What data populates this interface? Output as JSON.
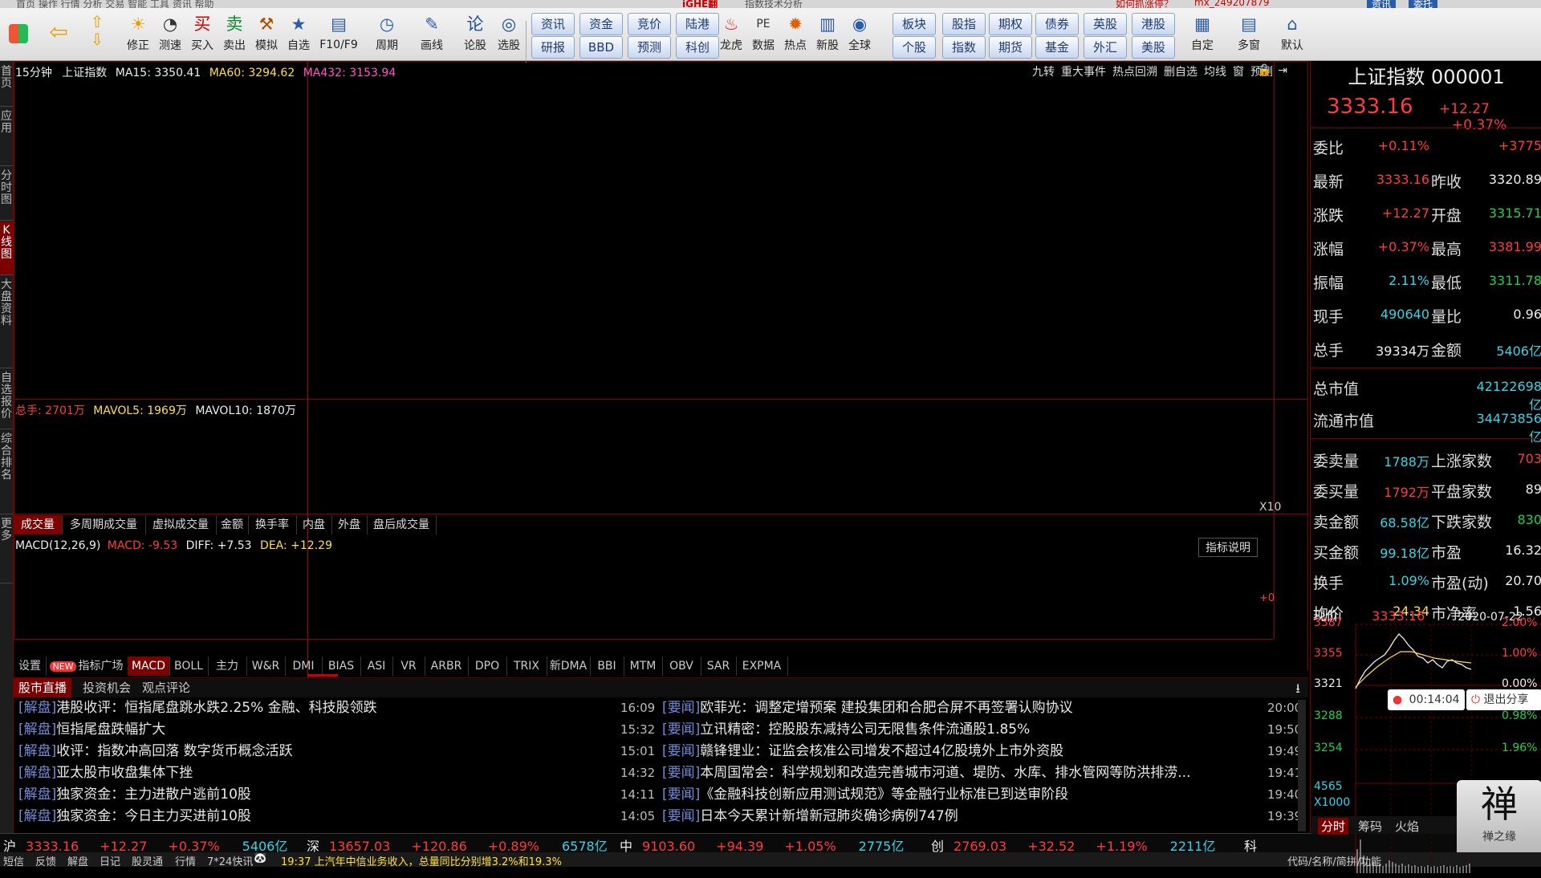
{
  "titlebar": {
    "center": "指数技术分析",
    "promo": "如何抓涨停？",
    "user": "mx_249207879",
    "btn_a": "资讯",
    "btn_b": "委托"
  },
  "toolbar": {
    "icon_buttons": [
      {
        "label": "修正",
        "icon": "hammer-fix-icon"
      },
      {
        "label": "测速",
        "icon": "clock-icon"
      },
      {
        "label": "买入",
        "icon": "buy-icon",
        "glyph": "买"
      },
      {
        "label": "卖出",
        "icon": "sell-icon",
        "glyph": "卖"
      },
      {
        "label": "模拟",
        "icon": "gavel-icon"
      },
      {
        "label": "自选",
        "icon": "star-icon"
      },
      {
        "label": "F10/F9",
        "icon": "document-icon"
      },
      {
        "label": "周期",
        "icon": "cycle-icon"
      },
      {
        "label": "画线",
        "icon": "pencil-icon"
      },
      {
        "label": "论股",
        "icon": "discuss-icon",
        "glyph": "论"
      },
      {
        "label": "选股",
        "icon": "select-stock-icon"
      }
    ],
    "pills_row1": [
      "资讯",
      "资金",
      "竞价",
      "陆港"
    ],
    "pills_row2": [
      "研报",
      "BBD",
      "预测",
      "科创"
    ],
    "mid_buttons": [
      {
        "label": "龙虎",
        "icon": "dragon-icon"
      },
      {
        "label": "数据",
        "icon": "pe-data-icon",
        "glyph": "PE"
      },
      {
        "label": "热点",
        "icon": "hot-icon"
      },
      {
        "label": "新股",
        "icon": "new-stock-icon"
      },
      {
        "label": "全球",
        "icon": "globe-icon"
      }
    ],
    "pills2_row1": [
      "板块",
      "股指",
      "期权",
      "债券",
      "英股",
      "港股"
    ],
    "pills2_row2": [
      "个股",
      "指数",
      "期货",
      "基金",
      "外汇",
      "美股"
    ],
    "right_buttons": [
      {
        "label": "自定",
        "icon": "custom-icon"
      },
      {
        "label": "多窗",
        "icon": "multi-window-icon"
      },
      {
        "label": "默认",
        "icon": "home-icon"
      }
    ]
  },
  "left_tabs": [
    "首页",
    "应用",
    "分时图",
    "K线图",
    "大盘资料",
    "自选报价",
    "综合排名",
    "更多"
  ],
  "chart": {
    "period": "15分钟",
    "name": "上证指数",
    "ma15": "MA15: 3350.41",
    "ma60": "MA60: 3294.62",
    "ma432": "MA432: 3153.94",
    "tools": [
      "九转",
      "重大事件",
      "热点回溯",
      "删自选",
      "均线",
      "窗",
      "预测"
    ],
    "vol_total": "总手: 2701万",
    "mavol5": "MAVOL5: 1969万",
    "mavol10": "MAVOL10: 1870万",
    "x10": "X10",
    "vol_tabs": [
      "成交量",
      "多周期成交量",
      "虚拟成交量",
      "金额",
      "换手率",
      "内盘",
      "外盘",
      "盘后成交量"
    ],
    "macd_name": "MACD(12,26,9)",
    "macd": "MACD: -9.53",
    "diff": "DIFF: +7.53",
    "dea": "DEA: +12.29",
    "ind_help": "指标说明",
    "zero": "+0"
  },
  "indicator_tabs": [
    "设置",
    "指标广场",
    "MACD",
    "BOLL",
    "主力",
    "W&R",
    "DMI",
    "BIAS",
    "ASI",
    "VR",
    "ARBR",
    "DPO",
    "TRIX",
    "新DMA",
    "BBI",
    "MTM",
    "OBV",
    "SAR",
    "EXPMA"
  ],
  "new_badge": "NEW",
  "news_tabs": [
    "股市直播",
    "投资机会",
    "观点评论"
  ],
  "news_left": [
    {
      "tag": "[解盘]",
      "title": "港股收评：恒指尾盘跳水跌2.25% 金融、科技股领跌",
      "time": "16:09"
    },
    {
      "tag": "[解盘]",
      "title": "恒指尾盘跌幅扩大",
      "time": "15:32"
    },
    {
      "tag": "[解盘]",
      "title": "收评：指数冲高回落 数字货币概念活跃",
      "time": "15:01"
    },
    {
      "tag": "[解盘]",
      "title": "亚太股市收盘集体下挫",
      "time": "14:32"
    },
    {
      "tag": "[解盘]",
      "title": "独家资金：主力进散户逃前10股",
      "time": "14:11"
    },
    {
      "tag": "[解盘]",
      "title": "独家资金：今日主力买进前10股",
      "time": "14:05"
    }
  ],
  "news_right": [
    {
      "tag": "[要闻]",
      "title": "欧菲光：调整定增预案 建投集团和合肥合屏不再签署认购协议",
      "time": "20:00"
    },
    {
      "tag": "[要闻]",
      "title": "立讯精密：控股股东减持公司无限售条件流通股1.85%",
      "time": "19:50"
    },
    {
      "tag": "[要闻]",
      "title": "赣锋锂业：证监会核准公司增发不超过4亿股境外上市外资股",
      "time": "19:49"
    },
    {
      "tag": "[要闻]",
      "title": "本周国常会：科学规划和改造完善城市河道、堤防、水库、排水管网等防洪排涝...",
      "time": "19:41"
    },
    {
      "tag": "[要闻]",
      "title": "《金融科技创新应用测试规范》等金融行业标准已到送审阶段",
      "time": "19:40"
    },
    {
      "tag": "[要闻]",
      "title": "日本今天累计新增新冠肺炎确诊病例747例",
      "time": "19:39"
    }
  ],
  "index_bar": [
    {
      "name": "沪",
      "price": "3333.16",
      "chg": "+12.27",
      "pct": "+0.37%",
      "amt": "5406亿"
    },
    {
      "name": "深",
      "price": "13657.03",
      "chg": "+120.86",
      "pct": "+0.89%",
      "amt": "6578亿"
    },
    {
      "name": "中",
      "price": "9103.60",
      "chg": "+94.39",
      "pct": "+1.05%",
      "amt": "2775亿"
    },
    {
      "name": "创",
      "price": "2769.03",
      "chg": "+32.52",
      "pct": "+1.19%",
      "amt": "2211亿"
    },
    {
      "name": "科",
      "price": "",
      "chg": "",
      "pct": "",
      "amt": ""
    }
  ],
  "statusbar": {
    "items": [
      "短信",
      "反馈",
      "解盘",
      "日记",
      "股灵通",
      "行情",
      "7*24快讯"
    ],
    "ticker": "19:37 上汽年中信业务收入，总量同比分别增3.2%和19.3%",
    "right": "代码/名称/简拼/功能"
  },
  "quote": {
    "title": "上证指数 000001",
    "price": "3333.16",
    "chg": "+12.27",
    "pct": "+0.37%",
    "rows": [
      {
        "l": "委比",
        "v": "+0.11%",
        "vc": "red",
        "l2": "",
        "v2": "+3775",
        "v2c": "red"
      },
      {
        "l": "最新",
        "v": "3333.16",
        "vc": "red",
        "l2": "昨收",
        "v2": "3320.89",
        "v2c": "white"
      },
      {
        "l": "涨跌",
        "v": "+12.27",
        "vc": "red",
        "l2": "开盘",
        "v2": "3315.71",
        "v2c": "green"
      },
      {
        "l": "涨幅",
        "v": "+0.37%",
        "vc": "red",
        "l2": "最高",
        "v2": "3381.99",
        "v2c": "red"
      },
      {
        "l": "振幅",
        "v": "2.11%",
        "vc": "cyan",
        "l2": "最低",
        "v2": "3311.78",
        "v2c": "green"
      },
      {
        "l": "现手",
        "v": "490640",
        "vc": "cyan",
        "l2": "量比",
        "v2": "0.96",
        "v2c": "white"
      },
      {
        "l": "总手",
        "v": "39334万",
        "vc": "white",
        "l2": "金额",
        "v2": "5406亿",
        "v2c": "cyan"
      }
    ],
    "rows2": [
      {
        "l": "总市值",
        "v": "42122698亿",
        "vc": "cyan"
      },
      {
        "l": "流通市值",
        "v": "34473856亿",
        "vc": "cyan"
      }
    ],
    "rows3": [
      {
        "l": "委卖量",
        "v": "1788万",
        "vc": "cyan",
        "l2": "上涨家数",
        "v2": "703",
        "v2c": "red"
      },
      {
        "l": "委买量",
        "v": "1792万",
        "vc": "red",
        "l2": "平盘家数",
        "v2": "89",
        "v2c": "white"
      },
      {
        "l": "卖金额",
        "v": "68.58亿",
        "vc": "cyan",
        "l2": "下跌家数",
        "v2": "830",
        "v2c": "green"
      },
      {
        "l": "买金额",
        "v": "99.18亿",
        "vc": "cyan",
        "l2": "市盈",
        "v2": "16.32",
        "v2c": "white"
      },
      {
        "l": "换手",
        "v": "1.09%",
        "vc": "cyan",
        "l2": "市盈(动)",
        "v2": "20.70",
        "v2c": "white"
      },
      {
        "l": "均价",
        "v": "24.34",
        "vc": "yellow",
        "l2": "市净率",
        "v2": "1.56",
        "v2c": "white"
      }
    ],
    "mini_label": "现价",
    "mini_price": "3333.16",
    "mini_date": "2020-07-22",
    "mini_y": [
      "3387",
      "3355",
      "3321",
      "3288",
      "3254"
    ],
    "mini_pct": [
      "2.00%",
      "1.00%",
      "0.00%",
      "0.98%",
      "1.96%"
    ],
    "mini_vol": "4565",
    "mini_x": "X1000",
    "timer": "00:14:04",
    "exit_share": "退出分享",
    "mini_tabs": [
      "分时",
      "筹码",
      "火焰"
    ],
    "logo_text": "禅之缘"
  },
  "colors": {
    "accent_red": "#7b0000",
    "up": "#ff3b3b",
    "down": "#19d34b",
    "blue_tag": "#6f8bd8"
  }
}
